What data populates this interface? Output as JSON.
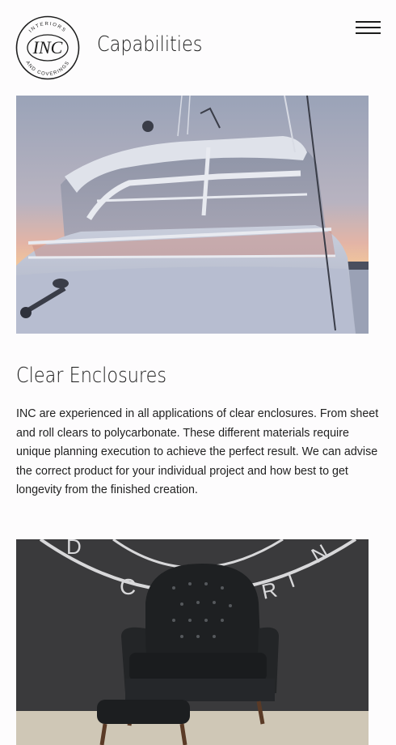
{
  "header": {
    "logo_main": "INC",
    "logo_ring": "INTERIORS AND COVERINGS",
    "title": "Capabilities",
    "menu_icon": "hamburger-menu-icon"
  },
  "sections": [
    {
      "image": "boat-windshield-sunset",
      "heading": "Clear Enclosures",
      "body": "INC are experienced in all applications of clear enclosures. From sheet and roll clears to polycarbonate. These different materials require unique planning execution to achieve the perfect result. We can advise the correct product for your individual project and how best to get longevity from the finished creation."
    },
    {
      "image": "leather-chesterfield-chair"
    }
  ],
  "colors": {
    "background": "#fdfcfd",
    "text": "#1c1c1c"
  }
}
